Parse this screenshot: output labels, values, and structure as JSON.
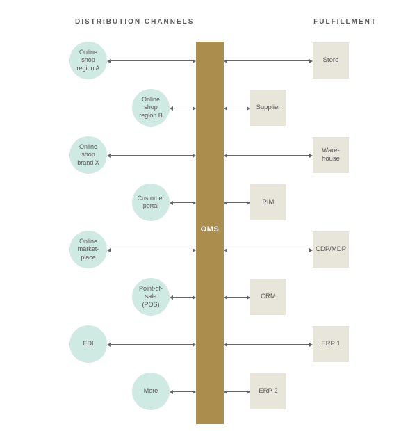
{
  "headers": {
    "left": "DISTRIBUTION CHANNELS",
    "right": "FULFILLMENT"
  },
  "center": {
    "label": "OMS"
  },
  "colors": {
    "circle": "#cfe9e3",
    "square": "#e8e5da",
    "bar": "#ab8d4d",
    "arrow": "#666666"
  },
  "distribution_channels": [
    {
      "id": "region-a",
      "label": "Online\nshop\nregion A",
      "column": "far"
    },
    {
      "id": "region-b",
      "label": "Online\nshop\nregion B",
      "column": "near"
    },
    {
      "id": "brand-x",
      "label": "Online\nshop\nbrand X",
      "column": "far"
    },
    {
      "id": "cust-portal",
      "label": "Customer\nportal",
      "column": "near"
    },
    {
      "id": "marketplace",
      "label": "Online\nmarket-\nplace",
      "column": "far"
    },
    {
      "id": "pos",
      "label": "Point-of-\nsale\n(POS)",
      "column": "near"
    },
    {
      "id": "edi",
      "label": "EDI",
      "column": "far"
    },
    {
      "id": "more",
      "label": "More",
      "column": "near"
    }
  ],
  "fulfillment": [
    {
      "id": "store",
      "label": "Store",
      "column": "far"
    },
    {
      "id": "supplier",
      "label": "Supplier",
      "column": "near"
    },
    {
      "id": "warehouse",
      "label": "Ware-\nhouse",
      "column": "far"
    },
    {
      "id": "pim",
      "label": "PIM",
      "column": "near"
    },
    {
      "id": "cdp",
      "label": "CDP/MDP",
      "column": "far"
    },
    {
      "id": "crm",
      "label": "CRM",
      "column": "near"
    },
    {
      "id": "erp1",
      "label": "ERP 1",
      "column": "far"
    },
    {
      "id": "erp2",
      "label": "ERP 2",
      "column": "near"
    }
  ]
}
